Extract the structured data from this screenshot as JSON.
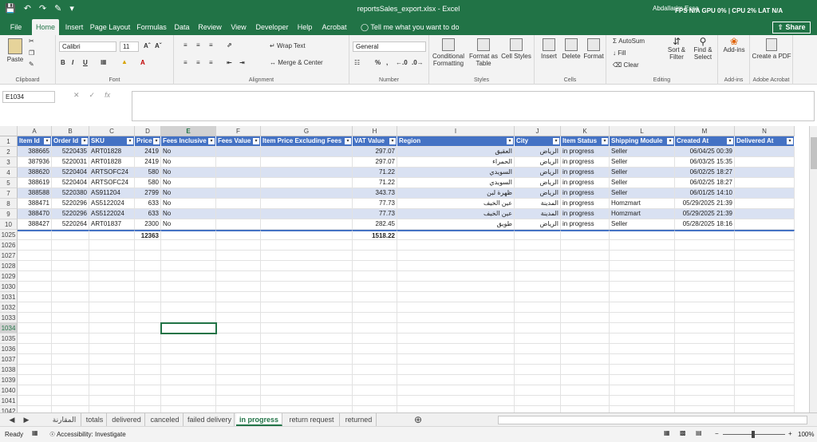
{
  "titlebar": {
    "title": "reportsSales_export.xlsx  -  Excel",
    "user": "Abdallarim Essa",
    "perf": "FPS N/A  GPU 0%  |  CPU 2%  LAT N/A"
  },
  "tabs": [
    "File",
    "Home",
    "Insert",
    "Page Layout",
    "Formulas",
    "Data",
    "Review",
    "View",
    "Developer",
    "Help",
    "Acrobat"
  ],
  "tellme": "Tell me what you want to do",
  "share": "Share",
  "ribbon": {
    "clipboard": {
      "paste": "Paste",
      "label": "Clipboard"
    },
    "font": {
      "name": "Calibri",
      "size": "11",
      "label": "Font"
    },
    "alignment": {
      "wrap": "Wrap Text",
      "merge": "Merge & Center",
      "label": "Alignment"
    },
    "number": {
      "format": "General",
      "label": "Number"
    },
    "styles": {
      "conditional": "Conditional Formatting",
      "format_table": "Format as Table",
      "cell_styles": "Cell Styles",
      "label": "Styles"
    },
    "cells": {
      "insert": "Insert",
      "delete": "Delete",
      "format": "Format",
      "label": "Cells"
    },
    "editing": {
      "autosum": "AutoSum",
      "fill": "Fill",
      "clear": "Clear",
      "sort": "Sort & Filter",
      "find": "Find & Select",
      "label": "Editing"
    },
    "addins": {
      "addins": "Add-ins",
      "label": "Add-ins"
    },
    "acrobat": {
      "create": "Create a PDF",
      "label": "Adobe Acrobat"
    }
  },
  "namebox": "E1034",
  "columns": [
    "A",
    "B",
    "C",
    "D",
    "E",
    "F",
    "G",
    "H",
    "I",
    "J",
    "K",
    "L",
    "M",
    "N"
  ],
  "headers": [
    "Item Id",
    "Order Id",
    "SKU",
    "Price",
    "Fees Inclusive",
    "Fees Value",
    "Item Price Excluding Fees",
    "VAT Value",
    "Region",
    "City",
    "Item Status",
    "Shipping Module",
    "Created At",
    "Delivered At"
  ],
  "rows": [
    {
      "n": "2",
      "cells": [
        "388665",
        "5220435",
        "ART01828",
        "2419",
        "No",
        "",
        "",
        "297.07",
        "العقيق",
        "الرياض",
        "in progress",
        "Seller",
        "06/04/25 00:39",
        ""
      ]
    },
    {
      "n": "3",
      "cells": [
        "387936",
        "5220031",
        "ART01828",
        "2419",
        "No",
        "",
        "",
        "297.07",
        "الحمراء",
        "الرياض",
        "in progress",
        "Seller",
        "06/03/25 15:35",
        ""
      ]
    },
    {
      "n": "4",
      "cells": [
        "388620",
        "5220404",
        "ARTSOFC24",
        "580",
        "No",
        "",
        "",
        "71.22",
        "السويدي",
        "الرياض",
        "in progress",
        "Seller",
        "06/02/25 18:27",
        ""
      ]
    },
    {
      "n": "5",
      "cells": [
        "388619",
        "5220404",
        "ARTSOFC24",
        "580",
        "No",
        "",
        "",
        "71.22",
        "السويدي",
        "الرياض",
        "in progress",
        "Seller",
        "06/02/25 18:27",
        ""
      ]
    },
    {
      "n": "7",
      "cells": [
        "388588",
        "5220380",
        "AS911204",
        "2799",
        "No",
        "",
        "",
        "343.73",
        "ظهرة لبن",
        "الرياض",
        "in progress",
        "Seller",
        "06/01/25 14:10",
        ""
      ]
    },
    {
      "n": "8",
      "cells": [
        "388471",
        "5220296",
        "AS5122024",
        "633",
        "No",
        "",
        "",
        "77.73",
        "عين الخيف",
        "المدينة",
        "in progress",
        "Homzmart",
        "05/29/2025 21:39",
        ""
      ]
    },
    {
      "n": "9",
      "cells": [
        "388470",
        "5220296",
        "AS5122024",
        "633",
        "No",
        "",
        "",
        "77.73",
        "عين الخيف",
        "المدينة",
        "in progress",
        "Homzmart",
        "05/29/2025 21:39",
        ""
      ]
    },
    {
      "n": "10",
      "cells": [
        "388427",
        "5220264",
        "ART01837",
        "2300",
        "No",
        "",
        "",
        "282.45",
        "طويق",
        "الرياض",
        "in progress",
        "Seller",
        "05/28/2025 18:16",
        ""
      ]
    }
  ],
  "totals": {
    "n": "1025",
    "price": "12363",
    "vat": "1518.22"
  },
  "empty_rows": [
    "1026",
    "1027",
    "1028",
    "1029",
    "1030",
    "1031",
    "1032",
    "1033",
    "1034",
    "1035",
    "1036",
    "1037",
    "1038",
    "1039",
    "1040",
    "1041",
    "1042"
  ],
  "sheets": [
    "المقارنة",
    "totals",
    "delivered",
    "canceled",
    "failed delivery",
    "in progress",
    "return request",
    "returned"
  ],
  "active_sheet": "in progress",
  "status": {
    "ready": "Ready",
    "accessibility": "Accessibility: Investigate",
    "zoom": "100%"
  },
  "colors": {
    "excel_green": "#217346",
    "table_header": "#4472c4",
    "band": "#d9e1f2"
  }
}
